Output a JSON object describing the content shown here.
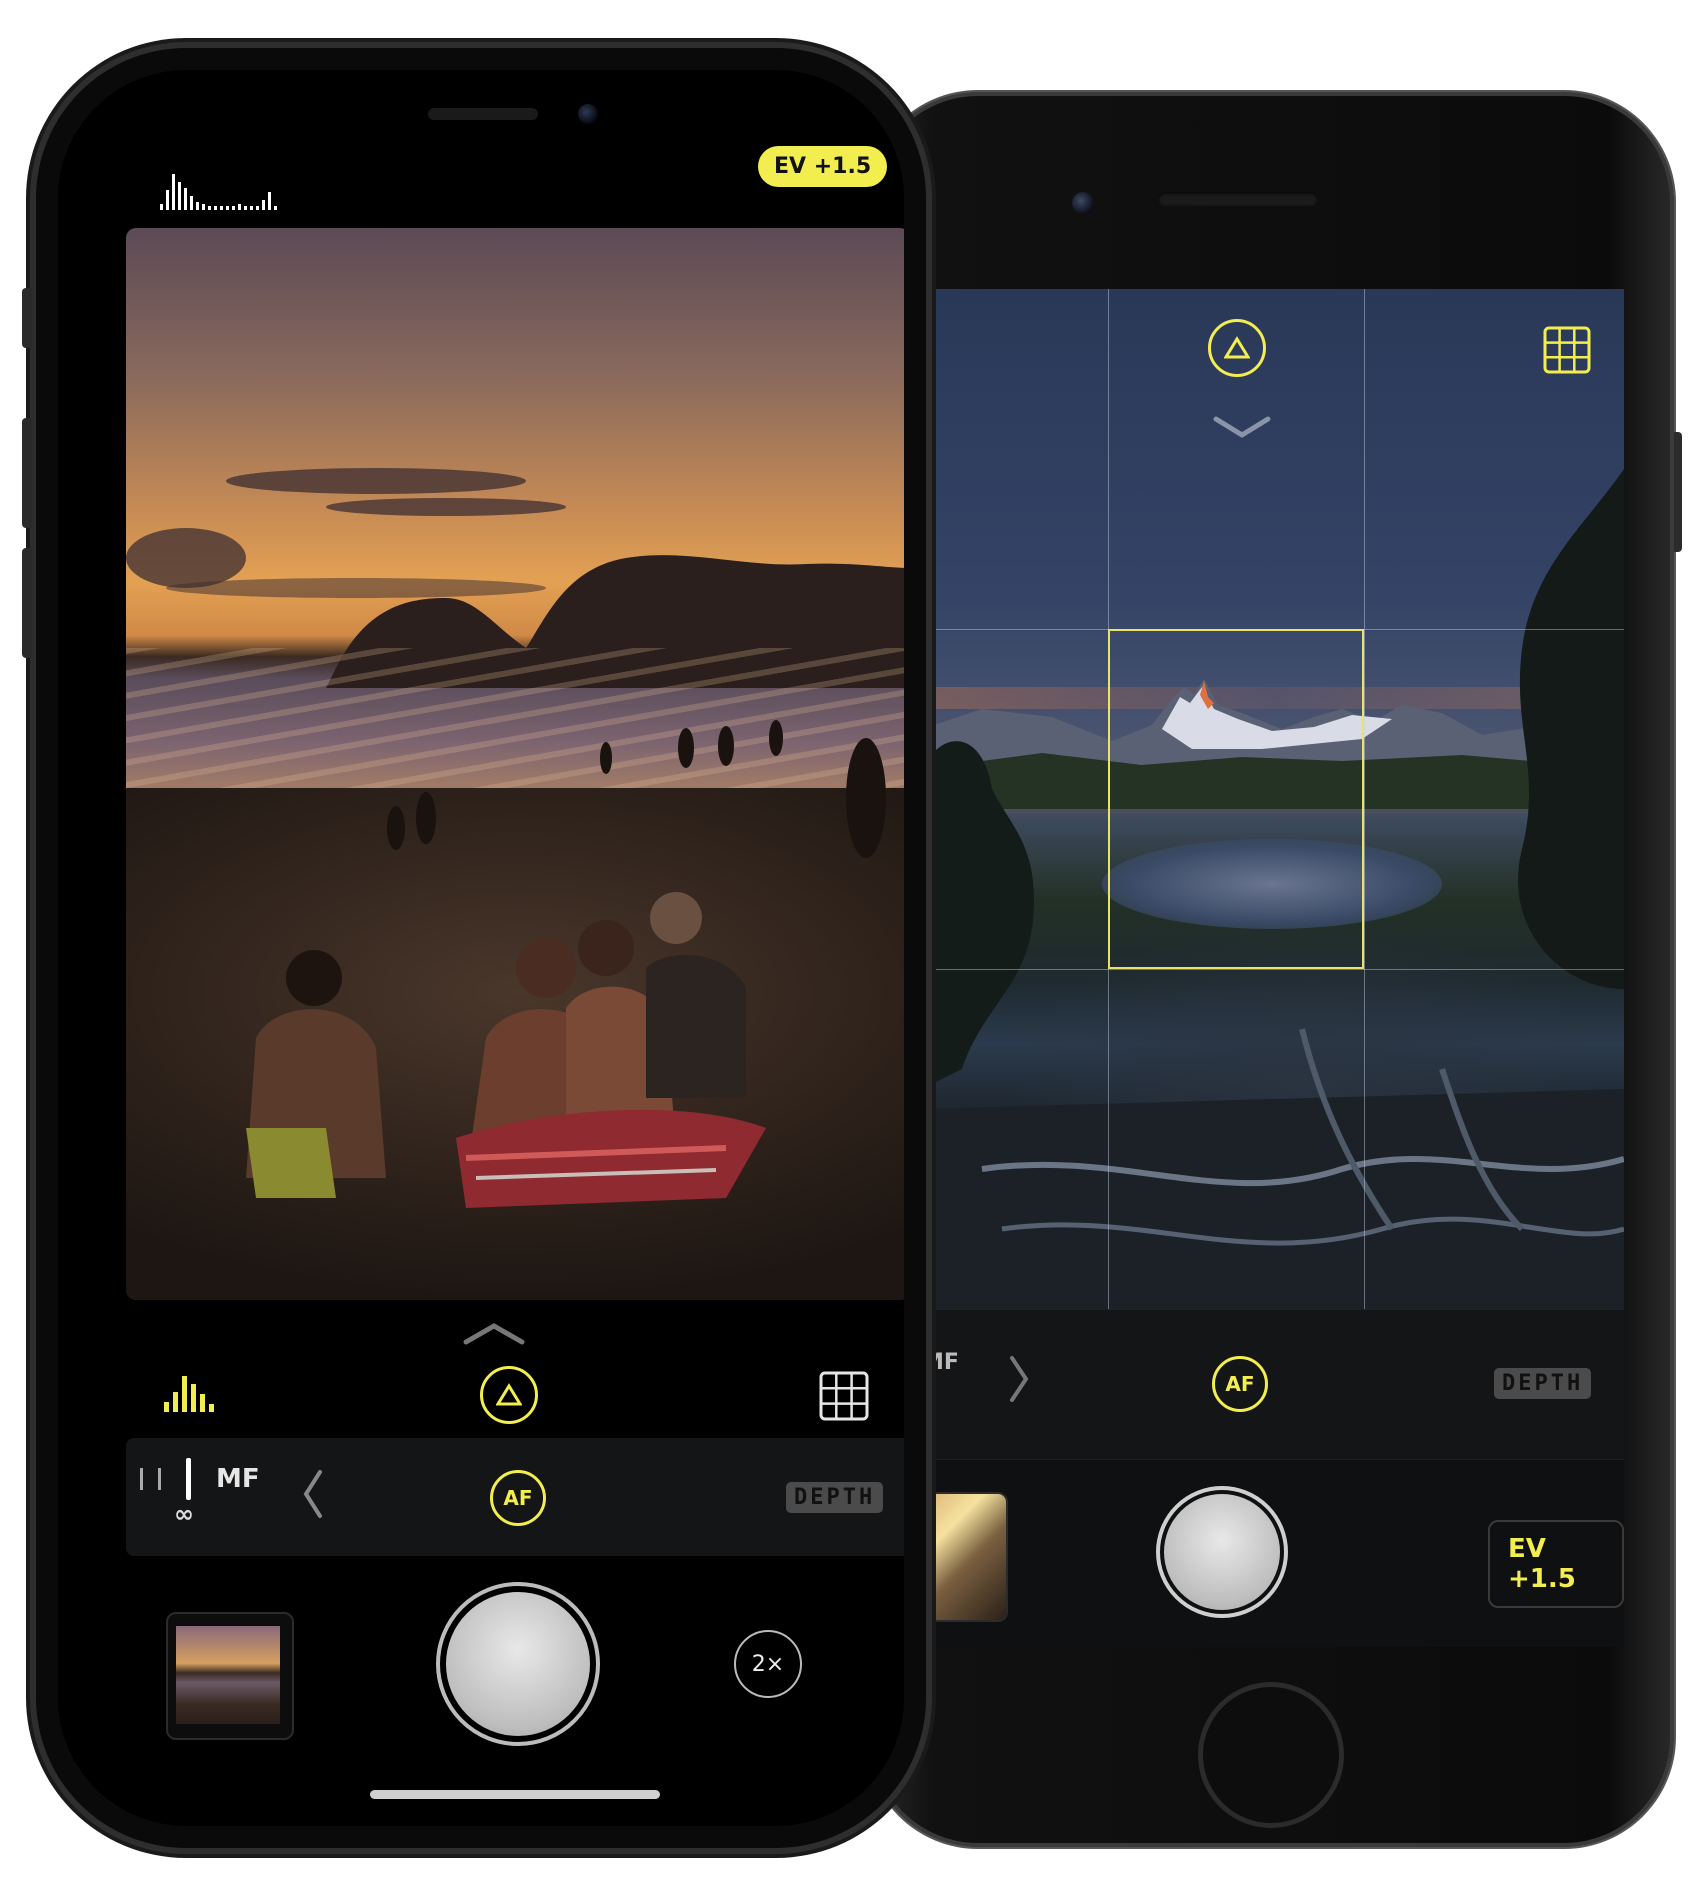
{
  "left_phone": {
    "ev_label": "EV +1.5",
    "manual_focus_label": "MF",
    "af_label": "AF",
    "depth_label": "DEPTH",
    "zoom_label": "2×",
    "infinity_symbol": "∞",
    "icons": [
      "histogram-icon",
      "exposure-triangle-icon",
      "grid-icon",
      "chevron-up-icon",
      "chevron-left-icon"
    ]
  },
  "right_phone": {
    "ev_label": "EV +1.5",
    "manual_focus_label": "MF",
    "af_label": "AF",
    "depth_label": "DEPTH",
    "icons": [
      "exposure-triangle-icon",
      "grid-icon",
      "chevron-down-icon",
      "chevron-right-icon"
    ]
  },
  "colors": {
    "accent": "#f3ee50",
    "frame": "#0a0a0a",
    "panel": "#141516"
  }
}
